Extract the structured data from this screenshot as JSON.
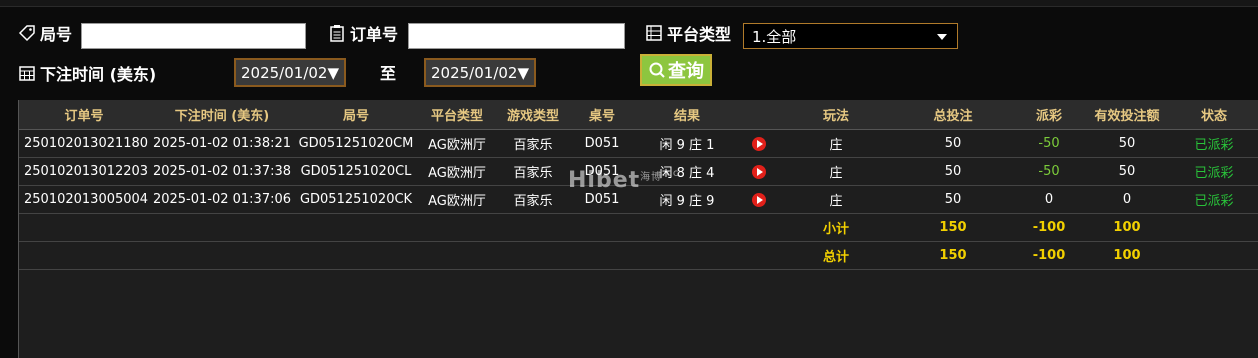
{
  "filters": {
    "round_label": "局号",
    "order_label": "订单号",
    "platform_label": "平台类型",
    "platform_selected": "1.全部",
    "bet_time_label": "下注时间 (美东)",
    "date_from": "2025/01/02▼",
    "to_label": "至",
    "date_to": "2025/01/02▼",
    "query_label": "查询"
  },
  "table": {
    "columns": [
      "订单号",
      "下注时间 (美东)",
      "局号",
      "平台类型",
      "游戏类型",
      "桌号",
      "结果",
      "",
      "玩法",
      "总投注",
      "派彩",
      "有效投注额",
      "状态"
    ],
    "rows": [
      {
        "order": "250102013021180",
        "time": "2025-01-02 01:38:21",
        "round": "GD051251020CM",
        "platform": "AG欧洲厅",
        "game": "百家乐",
        "table": "D051",
        "result": "闲 9 庄 1",
        "play": "庄",
        "bet": "50",
        "payout": "-50",
        "valid": "50",
        "status": "已派彩"
      },
      {
        "order": "250102013012203",
        "time": "2025-01-02 01:37:38",
        "round": "GD051251020CL",
        "platform": "AG欧洲厅",
        "game": "百家乐",
        "table": "D051",
        "result": "闲 8 庄 4",
        "play": "庄",
        "bet": "50",
        "payout": "-50",
        "valid": "50",
        "status": "已派彩"
      },
      {
        "order": "250102013005004",
        "time": "2025-01-02 01:37:06",
        "round": "GD051251020CK",
        "platform": "AG欧洲厅",
        "game": "百家乐",
        "table": "D051",
        "result": "闲 9 庄 9",
        "play": "庄",
        "bet": "50",
        "payout": "0",
        "valid": "0",
        "status": "已派彩"
      }
    ],
    "subtotal": {
      "label": "小计",
      "bet": "150",
      "payout": "-100",
      "valid": "100"
    },
    "total": {
      "label": "总计",
      "bet": "150",
      "payout": "-100",
      "valid": "100"
    }
  },
  "watermark": {
    "text": "Hibet",
    "sub": "海博",
    "suffix": ".cc"
  },
  "colors": {
    "accent_header": "#e6c882",
    "payout_negative": "#7ccc3a",
    "status_paid": "#29c33a",
    "totals": "#f2d000",
    "query_button": "#8dc63f"
  },
  "icons": [
    "tag-icon",
    "clipboard-icon",
    "list-icon",
    "calendar-icon",
    "search-icon",
    "play-icon",
    "chevron-down-icon"
  ]
}
